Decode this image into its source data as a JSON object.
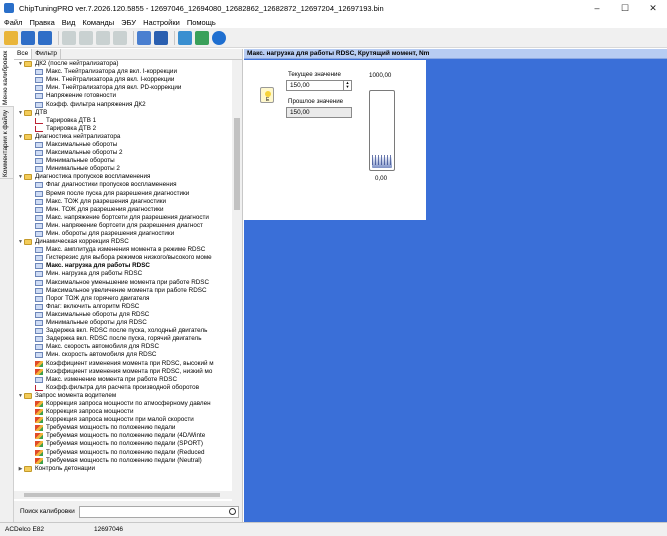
{
  "window": {
    "title": "ChipTuningPRO ver.7.2026.120.5855 - 12697046_12694080_12682862_12682872_12697204_12697193.bin",
    "controls": [
      "–",
      "☐",
      "✕"
    ]
  },
  "menu": [
    "Файл",
    "Правка",
    "Вид",
    "Команды",
    "ЭБУ",
    "Настройки",
    "Помощь"
  ],
  "toolbar_icons": [
    "open-folder-icon",
    "save-icon",
    "save-as-icon",
    "copy-icon",
    "paste-icon",
    "undo-icon",
    "redo-icon",
    "compare-icon",
    "checksum-icon",
    "connect-icon",
    "disconnect-icon",
    "help-icon"
  ],
  "side_tabs": [
    "Меню калибровок",
    "Комментарии к файлу"
  ],
  "left_tabs": [
    "Все",
    "Фильтр"
  ],
  "tree": [
    {
      "level": 1,
      "type": "folder",
      "expanded": true,
      "label": "ДК2 (после нейтрализатора)"
    },
    {
      "level": 2,
      "type": "map",
      "label": "Макс. Тнейтрализатора для вкл. I-коррекции"
    },
    {
      "level": 2,
      "type": "map",
      "label": "Мин. Тнейтрализатора для вкл. I-коррекции"
    },
    {
      "level": 2,
      "type": "map",
      "label": "Мин. Тнейтрализатора для вкл. PD-коррекции"
    },
    {
      "level": 2,
      "type": "map",
      "label": "Напряжение готовности"
    },
    {
      "level": 2,
      "type": "map",
      "label": "Коэфф. фильтра напряжения ДК2"
    },
    {
      "level": 1,
      "type": "folder",
      "expanded": true,
      "label": "ДТВ"
    },
    {
      "level": 2,
      "type": "curve",
      "label": "Тарировка ДТВ 1"
    },
    {
      "level": 2,
      "type": "curve",
      "label": "Тарировка ДТВ 2"
    },
    {
      "level": 1,
      "type": "folder",
      "expanded": true,
      "label": "Диагностика нейтрализатора"
    },
    {
      "level": 2,
      "type": "map",
      "label": "Максимальные обороты"
    },
    {
      "level": 2,
      "type": "map",
      "label": "Максимальные обороты 2"
    },
    {
      "level": 2,
      "type": "map",
      "label": "Минимальные обороты"
    },
    {
      "level": 2,
      "type": "map",
      "label": "Минимальные обороты 2"
    },
    {
      "level": 1,
      "type": "folder",
      "expanded": true,
      "label": "Диагностика пропусков воспламенения"
    },
    {
      "level": 2,
      "type": "map",
      "label": "Флаг диагностики пропусков воспламенения"
    },
    {
      "level": 2,
      "type": "map",
      "label": "Время после пуска для разрешения диагностики"
    },
    {
      "level": 2,
      "type": "map",
      "label": "Макс. ТОЖ для разрешения диагностики"
    },
    {
      "level": 2,
      "type": "map",
      "label": "Мин. ТОЖ для разрешения диагностики"
    },
    {
      "level": 2,
      "type": "map",
      "label": "Макс. напряжение бортсети для разрешения диагности"
    },
    {
      "level": 2,
      "type": "map",
      "label": "Мин. напряжение бортсети для разрешения диагност"
    },
    {
      "level": 2,
      "type": "map",
      "label": "Мин. обороты для разрешения диагностики"
    },
    {
      "level": 1,
      "type": "folder",
      "expanded": true,
      "label": "Динамическая коррекция RDSC"
    },
    {
      "level": 2,
      "type": "map",
      "label": "Макс. амплитуда изменения момента в режиме RDSC"
    },
    {
      "level": 2,
      "type": "map",
      "label": "Гистерезис для выбора режимов низкого/высокого моме"
    },
    {
      "level": 2,
      "type": "map",
      "label": "Макс. нагрузка для работы RDSC",
      "selected": true
    },
    {
      "level": 2,
      "type": "map",
      "label": "Мин. нагрузка для работы RDSC"
    },
    {
      "level": 2,
      "type": "map",
      "label": "Максимальное уменьшение момента при работе RDSC"
    },
    {
      "level": 2,
      "type": "map",
      "label": "Максимальное увеличение момента при работе RDSC"
    },
    {
      "level": 2,
      "type": "map",
      "label": "Порог ТОЖ для горячего двигателя"
    },
    {
      "level": 2,
      "type": "map",
      "label": "Флаг: включить алгоритм RDSC"
    },
    {
      "level": 2,
      "type": "map",
      "label": "Максимальные обороты для RDSC"
    },
    {
      "level": 2,
      "type": "map",
      "label": "Минимальные обороты для RDSC"
    },
    {
      "level": 2,
      "type": "map",
      "label": "Задержка вкл. RDSC после пуска, холодный двигатель"
    },
    {
      "level": 2,
      "type": "map",
      "label": "Задержка вкл. RDSC после пуска, горячий двигатель"
    },
    {
      "level": 2,
      "type": "map",
      "label": "Макс. скорость автомобиля для RDSC"
    },
    {
      "level": 2,
      "type": "map",
      "label": "Мин. скорость автомобиля для RDSC"
    },
    {
      "level": 2,
      "type": "chart",
      "label": "Коэффициент изменения момента при RDSC, высокий м"
    },
    {
      "level": 2,
      "type": "chart",
      "label": "Коэффициент изменения момента при RDSC, низкий мо"
    },
    {
      "level": 2,
      "type": "map",
      "label": "Макс. изменение момента при работе RDSC"
    },
    {
      "level": 2,
      "type": "curve",
      "label": "Коэфф.фильтра для расчета производной оборотов"
    },
    {
      "level": 1,
      "type": "folder",
      "expanded": true,
      "label": "Запрос момента водителем"
    },
    {
      "level": 2,
      "type": "chart",
      "label": "Коррекция запроса мощности по атмосферному давлен"
    },
    {
      "level": 2,
      "type": "chart",
      "label": "Коррекция запроса мощности"
    },
    {
      "level": 2,
      "type": "chart",
      "label": "Коррекция запроса мощности при малой скорости"
    },
    {
      "level": 2,
      "type": "chart",
      "label": "Требуемая мощность по положению педали"
    },
    {
      "level": 2,
      "type": "chart",
      "label": "Требуемая мощность по положению педали (4D/Winte"
    },
    {
      "level": 2,
      "type": "chart",
      "label": "Требуемая мощность по положению педали (SPORT)"
    },
    {
      "level": 2,
      "type": "chart",
      "label": "Требуемая мощность по положению педали (Reduced"
    },
    {
      "level": 2,
      "type": "chart",
      "label": "Требуемая мощность по положению педали (Neutral)"
    },
    {
      "level": 1,
      "type": "folder",
      "expanded": false,
      "label": "Контроль детонации"
    }
  ],
  "search": {
    "label": "Поиск калибровки",
    "value": ""
  },
  "main": {
    "header": "Макс. нагрузка для работы RDSC, Крутящий момент, Nm",
    "bulb_letter": "E",
    "current_label": "Текущее значение",
    "current_value": "150,00",
    "previous_label": "Прошлое значение",
    "previous_value": "150,00",
    "gauge_max": "1000,00",
    "gauge_min": "0,00",
    "gauge_fraction": 0.15
  },
  "status": [
    "ACDelco E82",
    "12697046"
  ],
  "colors": {
    "workspace": "#3a6fd8",
    "header": "#b7ccf2",
    "folder": "#f3cc5a"
  }
}
